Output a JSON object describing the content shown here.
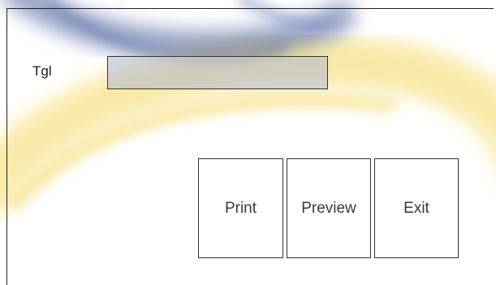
{
  "form": {
    "date_label": "Tgl",
    "date_value": ""
  },
  "buttons": {
    "print": "Print",
    "preview": "Preview",
    "exit": "Exit"
  },
  "colors": {
    "swoosh_blue": "#2f4a8a",
    "swoosh_yellow": "#f2d24a",
    "input_fill": "#b9bfd6",
    "border": "#333333"
  }
}
